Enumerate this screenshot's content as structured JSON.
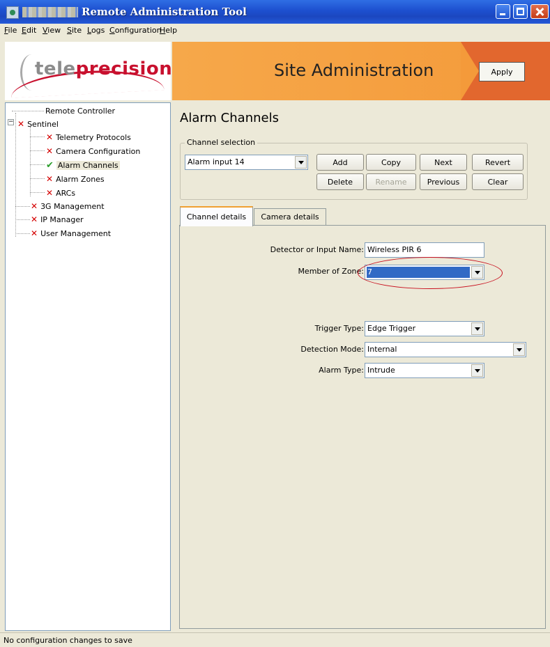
{
  "window": {
    "title": "Remote Administration Tool"
  },
  "menu": [
    "File",
    "Edit",
    "View",
    "Site",
    "Logs",
    "Configuration",
    "Help"
  ],
  "banner": {
    "logo_part1": "tele",
    "logo_part2": "precision",
    "title": "Site Administration",
    "apply_label": "Apply"
  },
  "tree": {
    "remote_controller": "Remote Controller",
    "sentinel": "Sentinel",
    "telemetry": "Telemetry Protocols",
    "camera_config": "Camera Configuration",
    "alarm_channels": "Alarm Channels",
    "alarm_zones": "Alarm Zones",
    "arcs": "ARCs",
    "g3": "3G Management",
    "ip_manager": "IP Manager",
    "user_mgmt": "User Management"
  },
  "main": {
    "title": "Alarm Channels",
    "channel_selection_label": "Channel selection",
    "channel_value": "Alarm input 14",
    "buttons": {
      "add": "Add",
      "copy": "Copy",
      "next": "Next",
      "revert": "Revert",
      "delete": "Delete",
      "rename": "Rename",
      "previous": "Previous",
      "clear": "Clear"
    },
    "tabs": {
      "channel_details": "Channel details",
      "camera_details": "Camera details"
    },
    "fields": {
      "detector_label": "Detector or Input Name:",
      "detector_value": "Wireless PIR 6",
      "zone_label": "Member of Zone:",
      "zone_value": "7",
      "trigger_label": "Trigger Type:",
      "trigger_value": "Edge Trigger",
      "detection_label": "Detection Mode:",
      "detection_value": "Internal",
      "alarm_label": "Alarm Type:",
      "alarm_value": "Intrude"
    }
  },
  "status": {
    "text": "No configuration changes to save"
  },
  "colors": {
    "accent": "#f49a3a",
    "banner_red": "#e2672e",
    "brand_red": "#c8102e",
    "selection": "#316ac5"
  }
}
